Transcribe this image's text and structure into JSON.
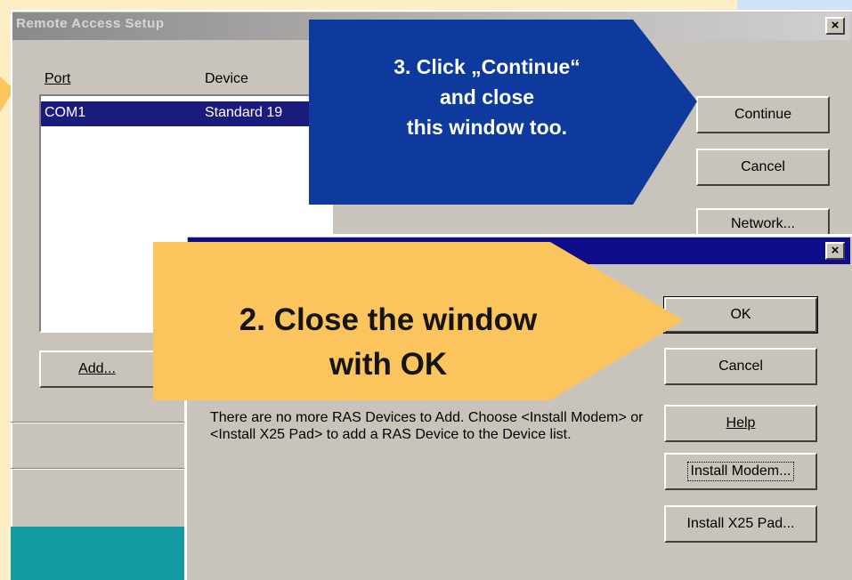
{
  "main_window": {
    "title": "Remote Access Setup",
    "close_glyph": "×",
    "columns": {
      "port": "Port",
      "device": "Device"
    },
    "rows": [
      {
        "port": "COM1",
        "device": "Standard 19"
      }
    ],
    "buttons": {
      "continue": "Continue",
      "cancel": "Cancel",
      "network": "Network...",
      "add": "Add..."
    }
  },
  "dialog": {
    "close_glyph": "×",
    "buttons": {
      "ok": "OK",
      "cancel": "Cancel",
      "help": "Help",
      "install_modem": "Install Modem...",
      "install_x25": "Install X25 Pad..."
    },
    "message": "There are no more RAS Devices to Add. Choose <Install Modem> or <Install X25 Pad> to add a RAS Device to the Device list."
  },
  "callouts": {
    "blue": {
      "line1": "3. Click „Continue“",
      "line2": "and close",
      "line3": "this window too.",
      "color": "#0d3a9c"
    },
    "yellow": {
      "line1": "2. Close the window",
      "line2": "with OK",
      "color": "#fcc45c"
    }
  },
  "colors": {
    "titlebar_active": "#0f0c8a",
    "selection": "#1b1a7d",
    "background": "#fdeec6",
    "teal": "#149aa3"
  }
}
